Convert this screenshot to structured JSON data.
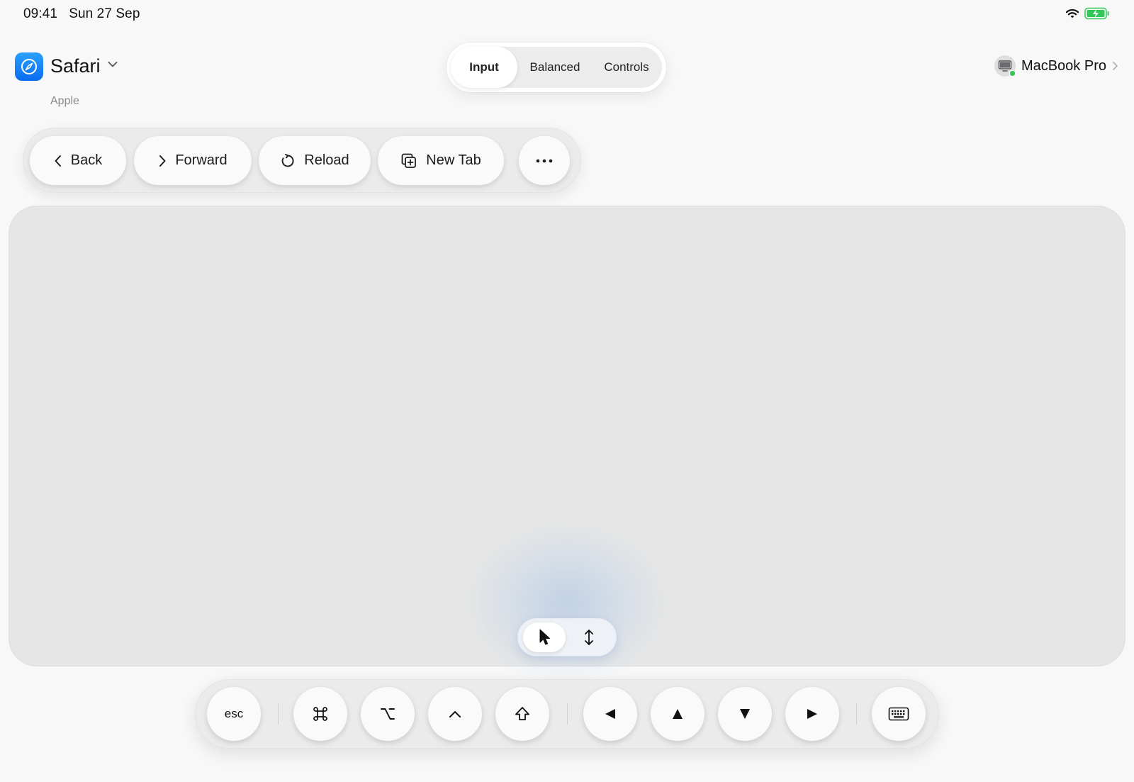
{
  "status": {
    "time": "09:41",
    "date": "Sun 27 Sep"
  },
  "app": {
    "name": "Safari",
    "vendor": "Apple",
    "icon": "compass-icon"
  },
  "modes": {
    "items": [
      "Input",
      "Balanced",
      "Controls"
    ],
    "selected": "Input"
  },
  "device": {
    "name": "MacBook Pro",
    "icon": "desktop-icon",
    "status_color": "#34c759"
  },
  "toolbar": {
    "back": "Back",
    "forward": "Forward",
    "reload": "Reload",
    "new_tab": "New Tab"
  },
  "pointer_modes": {
    "items": [
      "pointer-icon",
      "scroll-icon"
    ],
    "selected": "pointer-icon"
  },
  "keys": {
    "esc": "esc",
    "command": "⌘",
    "option": "⌥",
    "control": "^",
    "shift": "⇧"
  },
  "colors": {
    "accent": "#0a84ff",
    "background": "#f8f8f8",
    "canvas": "#e6e6e6",
    "battery": "#34c759"
  }
}
